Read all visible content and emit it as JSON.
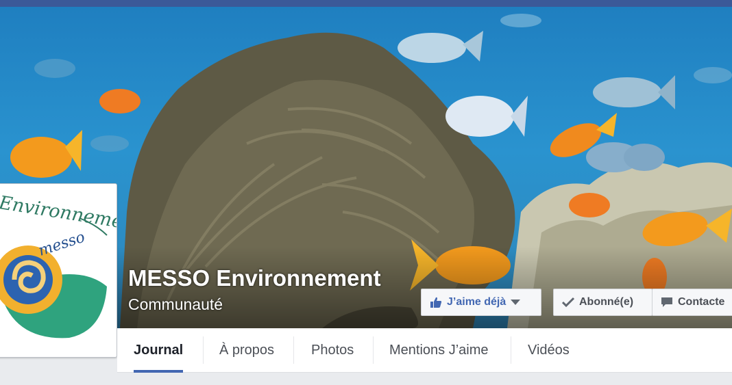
{
  "page": {
    "name": "MESSO Environnement",
    "category": "Communauté"
  },
  "profile": {
    "logo_text": "Environnement",
    "logo_subtext": "messo"
  },
  "actions": {
    "like_label": "J’aime déjà",
    "follow_label": "Abonné(e)",
    "contact_label": "Contacte"
  },
  "tabs": [
    {
      "label": "Journal",
      "active": true
    },
    {
      "label": "À propos",
      "active": false
    },
    {
      "label": "Photos",
      "active": false
    },
    {
      "label": "Mentions J’aime",
      "active": false
    },
    {
      "label": "Vidéos",
      "active": false
    }
  ],
  "colors": {
    "brand_blue": "#4267b2",
    "topbar": "#3b5998"
  },
  "icons": [
    "thumbs-up-icon",
    "caret-down-icon",
    "check-icon",
    "message-icon"
  ]
}
